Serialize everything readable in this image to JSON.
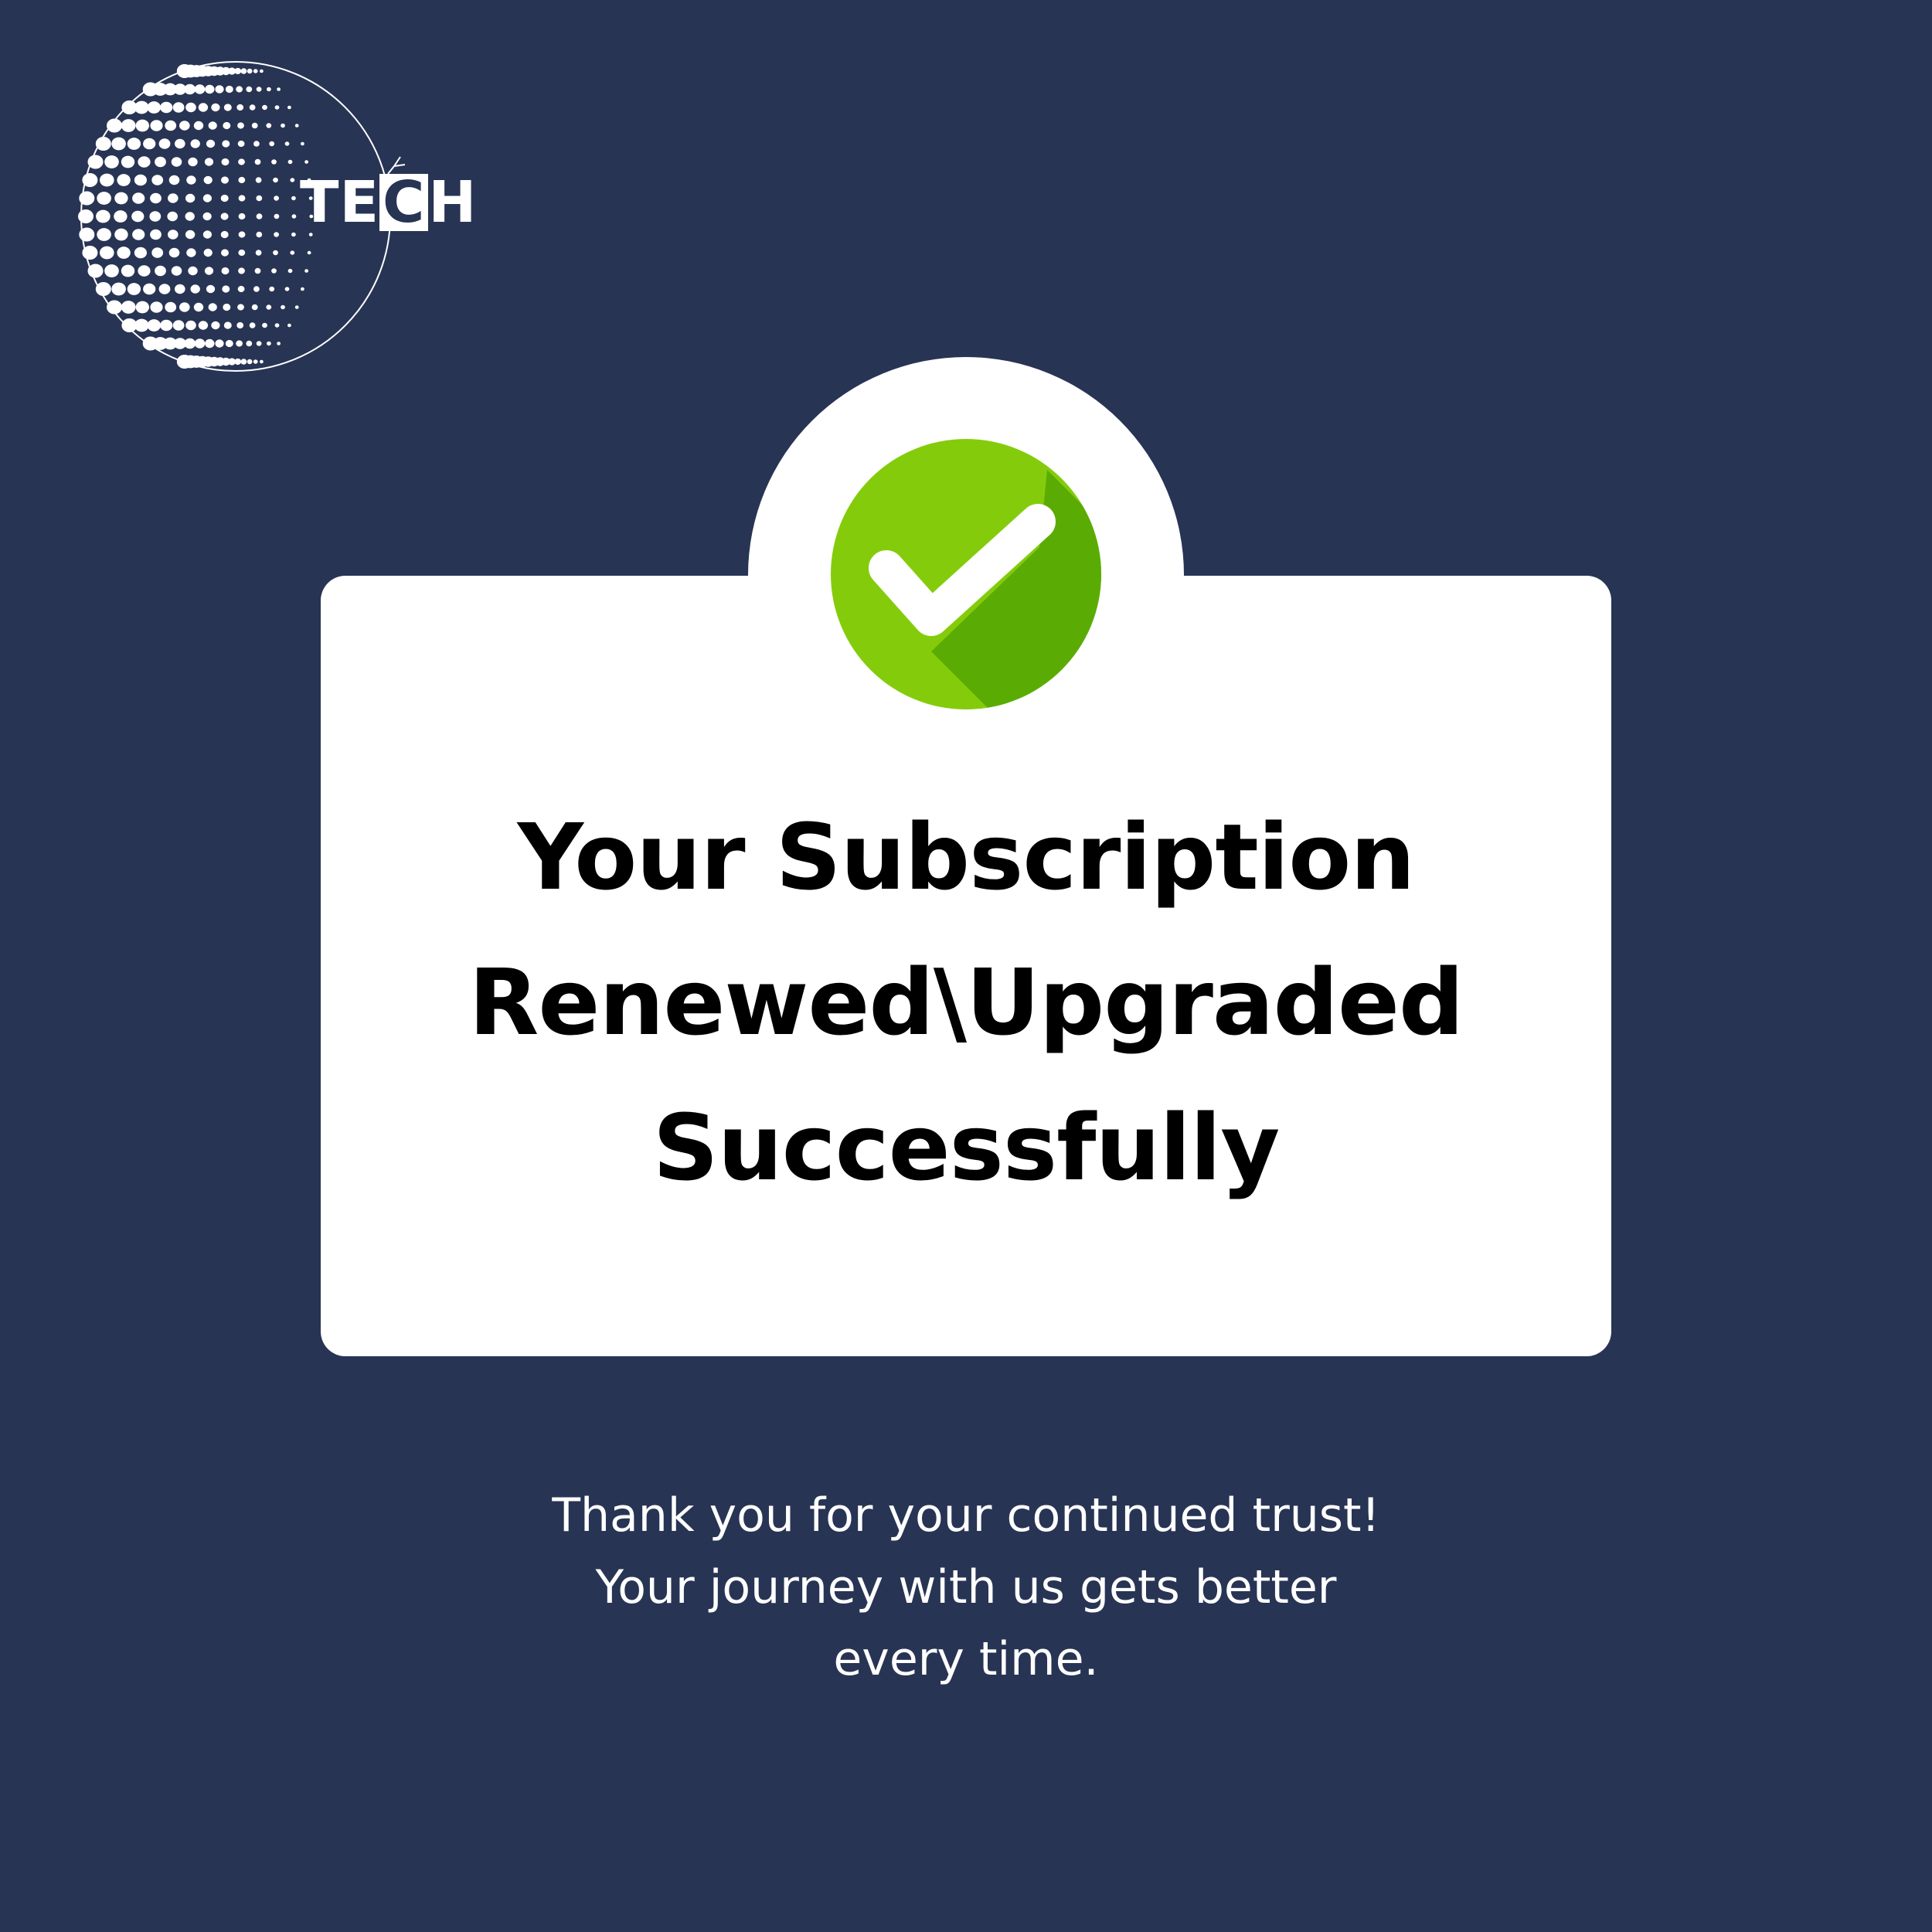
{
  "brand": {
    "logo_icon": "dotted-globe-icon",
    "name_prefix": "TE",
    "name_boxed_letter": "C",
    "name_suffix": "H"
  },
  "status": {
    "icon": "check-circle-icon",
    "headline_lines": [
      "Your Subscription",
      "Renewed\\Upgraded",
      "Successfully"
    ]
  },
  "message": {
    "lines": [
      "Thank you for your continued trust!",
      "Your journey with us gets better",
      "every time."
    ]
  },
  "colors": {
    "background": "#283454",
    "card": "#ffffff",
    "check_green": "#84cc0b",
    "check_shadow": "#5aac05",
    "text_dark": "#000000",
    "text_light": "#ffffff"
  }
}
